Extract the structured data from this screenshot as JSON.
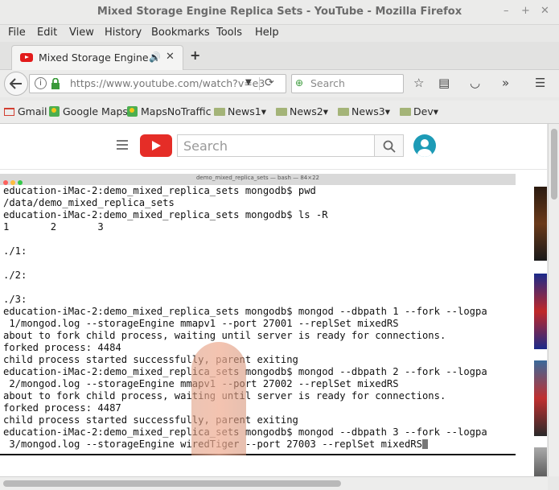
{
  "window": {
    "title": "Mixed Storage Engine Replica Sets - YouTube - Mozilla Firefox",
    "controls": [
      "–",
      "+",
      "✕"
    ]
  },
  "menu": [
    "File",
    "Edit",
    "View",
    "History",
    "Bookmarks",
    "Tools",
    "Help"
  ],
  "tab": {
    "label": "Mixed Storage Engine…",
    "speaker": "🔊",
    "close": "✕",
    "new_tab": "+"
  },
  "nav": {
    "url": "https://www.youtube.com/watch?v=e3",
    "search_placeholder": "Search"
  },
  "bookmarks": [
    "Gmail",
    "Google Maps",
    "MapsNoTraffic",
    "News1",
    "News2",
    "News3",
    "Dev"
  ],
  "youtube": {
    "search_placeholder": "Search"
  },
  "terminal": {
    "window_title": "demo_mixed_replica_sets — bash — 84×22",
    "lines": [
      "education-iMac-2:demo_mixed_replica_sets mongodb$ pwd",
      "/data/demo_mixed_replica_sets",
      "education-iMac-2:demo_mixed_replica_sets mongodb$ ls -R",
      "1       2       3",
      "",
      "./1:",
      "",
      "./2:",
      "",
      "./3:",
      "education-iMac-2:demo_mixed_replica_sets mongodb$ mongod --dbpath 1 --fork --logpa",
      " 1/mongod.log --storageEngine mmapv1 --port 27001 --replSet mixedRS",
      "about to fork child process, waiting until server is ready for connections.",
      "forked process: 4484",
      "child process started successfully, parent exiting",
      "education-iMac-2:demo_mixed_replica_sets mongodb$ mongod --dbpath 2 --fork --logpa",
      " 2/mongod.log --storageEngine mmapv1 --port 27002 --replSet mixedRS",
      "about to fork child process, waiting until server is ready for connections.",
      "forked process: 4487",
      "child process started successfully, parent exiting",
      "education-iMac-2:demo_mixed_replica_sets mongodb$ mongod --dbpath 3 --fork --logpa",
      " 3/mongod.log --storageEngine wiredTiger --port 27003 --replSet mixedRS"
    ]
  },
  "colors": {
    "youtube_red": "#e52d27",
    "chrome_bg": "#e8e8e7",
    "lock_green": "#3a9a3a"
  }
}
